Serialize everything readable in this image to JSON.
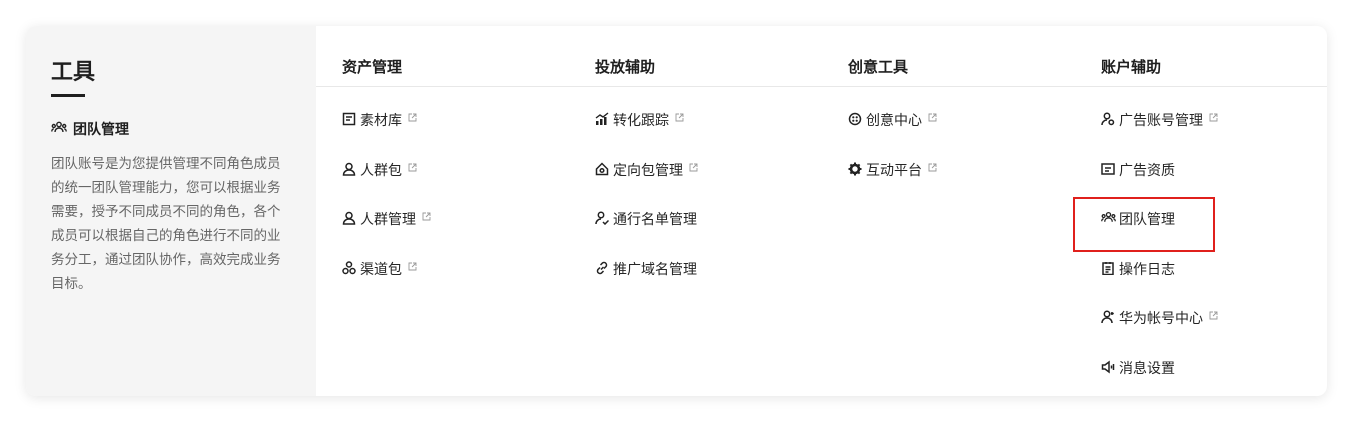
{
  "left_panel": {
    "title": "工具",
    "section_title": "团队管理",
    "section_icon": "team-icon",
    "description": "团队账号是为您提供管理不同角色成员的统一团队管理能力，您可以根据业务需要，授予不同成员不同的角色，各个成员可以根据自己的角色进行不同的业务分工，通过团队协作，高效完成业务目标。"
  },
  "columns": [
    {
      "header": "资产管理",
      "items": [
        {
          "label": "素材库",
          "icon": "library-icon",
          "external": true
        },
        {
          "label": "人群包",
          "icon": "person-icon",
          "external": true
        },
        {
          "label": "人群管理",
          "icon": "person-icon",
          "external": true
        },
        {
          "label": "渠道包",
          "icon": "channel-icon",
          "external": true
        }
      ]
    },
    {
      "header": "投放辅助",
      "items": [
        {
          "label": "转化跟踪",
          "icon": "chart-icon",
          "external": true
        },
        {
          "label": "定向包管理",
          "icon": "home-target-icon",
          "external": true
        },
        {
          "label": "通行名单管理",
          "icon": "person-check-icon",
          "external": false
        },
        {
          "label": "推广域名管理",
          "icon": "link-icon",
          "external": false
        }
      ]
    },
    {
      "header": "创意工具",
      "items": [
        {
          "label": "创意中心",
          "icon": "creative-icon",
          "external": true
        },
        {
          "label": "互动平台",
          "icon": "gear-icon",
          "external": true
        }
      ]
    },
    {
      "header": "账户辅助",
      "items": [
        {
          "label": "广告账号管理",
          "icon": "account-icon",
          "external": true
        },
        {
          "label": "广告资质",
          "icon": "id-card-icon",
          "external": false
        },
        {
          "label": "团队管理",
          "icon": "team-icon",
          "external": false
        },
        {
          "label": "操作日志",
          "icon": "clipboard-icon",
          "external": false
        },
        {
          "label": "华为帐号中心",
          "icon": "person-key-icon",
          "external": true
        },
        {
          "label": "消息设置",
          "icon": "speaker-icon",
          "external": false
        }
      ]
    }
  ],
  "colors": {
    "highlight_border": "#e0201c",
    "left_panel_bg": "#f5f5f5"
  }
}
